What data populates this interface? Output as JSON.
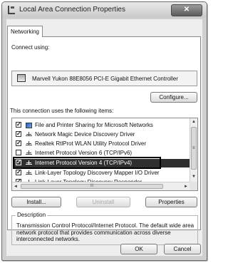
{
  "window": {
    "title": "Local Area Connection Properties",
    "close_label": "✕"
  },
  "tabs": [
    "Networking"
  ],
  "connect_using": {
    "label": "Connect using:",
    "adapter": "Marvell Yukon 88E8056 PCI-E Gigabit Ethernet Controller",
    "configure_label": "Configure..."
  },
  "items_label": "This connection uses the following items:",
  "items": [
    {
      "label": "File and Printer Sharing for Microsoft Networks",
      "checked": "✓",
      "icon": "service-icon"
    },
    {
      "label": "Network Magic Device Discovery Driver",
      "checked": "✓",
      "icon": "protocol-icon"
    },
    {
      "label": "Realtek RtlProt WLAN Utility Protocol Driver",
      "checked": "✓",
      "icon": "protocol-icon"
    },
    {
      "label": "Internet Protocol Version 6 (TCP/IPv6)",
      "checked": "",
      "icon": "protocol-icon"
    },
    {
      "label": "Internet Protocol Version 4 (TCP/IPv4)",
      "checked": "✓",
      "icon": "protocol-icon"
    },
    {
      "label": "Link-Layer Topology Discovery Mapper I/O Driver",
      "checked": "✓",
      "icon": "protocol-icon"
    },
    {
      "label": "Link-Layer Topology Discovery Responder",
      "checked": "✓",
      "icon": "protocol-icon"
    }
  ],
  "scroll": {
    "up": "▲",
    "down": "▼",
    "left": "◄",
    "right": "►",
    "thumb_grip": "≡",
    "hthumb_grip": "III"
  },
  "item_buttons": {
    "install": "Install...",
    "uninstall": "Uninstall",
    "properties": "Properties"
  },
  "description": {
    "legend": "Description",
    "text": "Transmission Control Protocol/Internet Protocol. The default wide area network protocol that provides communication across diverse interconnected networks."
  },
  "dialog_buttons": {
    "ok": "OK",
    "cancel": "Cancel"
  },
  "colors": {
    "selection": "#2f2f2f",
    "dialog_bg": "#eeeeee"
  }
}
